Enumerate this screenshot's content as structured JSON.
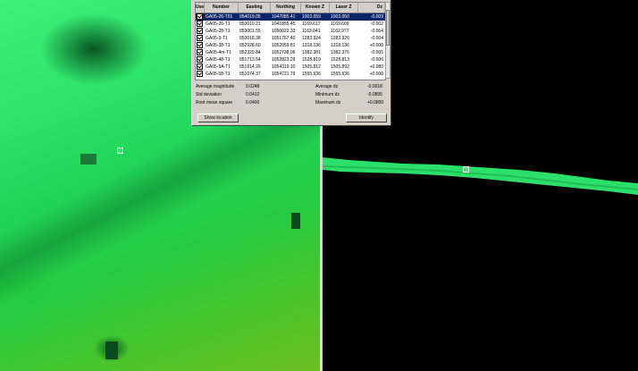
{
  "table": {
    "headers": [
      "Use",
      "Number",
      "Easting",
      "Northing",
      "Known Z",
      "Laser Z",
      "Dz"
    ],
    "rows": [
      {
        "number": "GA05-26-T01",
        "easting": "954019.05",
        "northing": "1047085.41",
        "known_z": "1003.059",
        "laser_z": "1003.050",
        "dz": "-0.009",
        "selected": true
      },
      {
        "number": "GA05-26-T1",
        "easting": "953019.21",
        "northing": "1041855.45",
        "known_z": "1169.617",
        "laser_z": "1169.609",
        "dz": "-0.002",
        "selected": false
      },
      {
        "number": "GA05-28-T1",
        "easting": "953001.55",
        "northing": "1050022.33",
        "known_z": "1163.041",
        "laser_z": "1162.977",
        "dz": "-0.064",
        "selected": false
      },
      {
        "number": "GA05-3-T1",
        "easting": "953018.38",
        "northing": "1051767.40",
        "known_z": "1283.924",
        "laser_z": "1283.920",
        "dz": "-0.004",
        "selected": false
      },
      {
        "number": "GA05-38-T1",
        "easting": "952928.60",
        "northing": "1052059.81",
        "known_z": "1318.136",
        "laser_z": "1318.136",
        "dz": "+0.000",
        "selected": false
      },
      {
        "number": "GA05-4m-T1",
        "easting": "952329.84",
        "northing": "1052738.06",
        "known_z": "1382.381",
        "laser_z": "1382.376",
        "dz": "-0.005",
        "selected": false
      },
      {
        "number": "GA05-48-T1",
        "easting": "951713.54",
        "northing": "1052823.29",
        "known_z": "1528.819",
        "laser_z": "1528.813",
        "dz": "-0.006",
        "selected": false
      },
      {
        "number": "GA05-5A-T1",
        "easting": "951914.26",
        "northing": "1054319.10",
        "known_z": "1505.812",
        "laser_z": "1505.892",
        "dz": "+0.080",
        "selected": false
      },
      {
        "number": "GA05-58-T1",
        "easting": "951074.37",
        "northing": "1054721.79",
        "known_z": "1555.636",
        "laser_z": "1555.636",
        "dz": "+0.000",
        "selected": false
      }
    ]
  },
  "stats": {
    "avg_magnitude_label": "Average magnitude",
    "avg_magnitude_value": "0.0248",
    "std_dev_label": "Std deviation",
    "std_dev_value": "0.0412",
    "rms_label": "Root mean square",
    "rms_value": "0.0400",
    "avg_dz_label": "Average dz",
    "avg_dz_value": "-0.0018",
    "min_dz_label": "Minimum dz",
    "min_dz_value": "-0.0895",
    "max_dz_label": "Maximum dz",
    "max_dz_value": "+0.0800"
  },
  "buttons": {
    "show_location": "Show location",
    "identify": "Identify"
  },
  "colors": {
    "selection": "#0a246a",
    "dialog_face": "#d4d0c8",
    "profile_green": "#2be06a"
  },
  "icons": {
    "use_check": "checkbox-checked-icon"
  }
}
